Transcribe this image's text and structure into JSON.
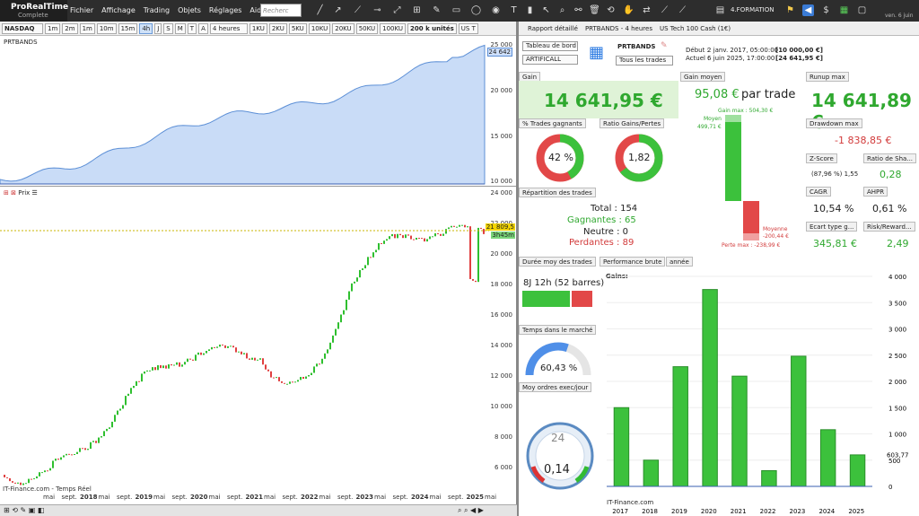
{
  "app": {
    "name": "ProRealTime",
    "edition": "Complete"
  },
  "menu": [
    "Fichier",
    "Affichage",
    "Trading",
    "Objets",
    "Réglages",
    "Aide"
  ],
  "search": {
    "placeholder": "Recherc"
  },
  "top_right": {
    "layout": "4.FORMATION",
    "date": "ven. 6 juin"
  },
  "chart_toolbar": {
    "symbol": "NASDAQ",
    "timeframes": [
      "1m",
      "2m",
      "1m",
      "10m",
      "15m",
      "4h",
      "J",
      "S",
      "M",
      "T",
      "A"
    ],
    "interval": "4 heures",
    "unit_buttons": [
      "1KU",
      "2KU",
      "5KU",
      "10KU",
      "20KU",
      "50KU",
      "100KU"
    ],
    "units": "200 k unités",
    "instrument_short": "US T"
  },
  "equity_pane": {
    "label": "PRTBANDS",
    "last_value": "24 642",
    "y_ticks": [
      "25 000",
      "20 000",
      "15 000",
      "10 000"
    ]
  },
  "price_pane": {
    "label": "Prix",
    "last_price": "21 809,5",
    "countdown": "3h45m",
    "y_ticks": [
      "24 000",
      "22 000",
      "20 000",
      "18 000",
      "16 000",
      "14 000",
      "12 000",
      "10 000",
      "8 000",
      "6 000"
    ],
    "x_ticks": [
      "mai",
      "sept.",
      "2018",
      "mai",
      "sept.",
      "2019",
      "mai",
      "sept.",
      "2020",
      "mai",
      "sept.",
      "2021",
      "mai",
      "sept.",
      "2022",
      "mai",
      "sept.",
      "2023",
      "mai",
      "sept.",
      "2024",
      "mai",
      "sept.",
      "2025",
      "mai"
    ],
    "source": "IT-Finance.com - Temps Réel"
  },
  "report_header": {
    "title": "Rapport détaillé",
    "system": "PRTBANDS - 4 heures",
    "instrument": "US Tech 100 Cash (1€)"
  },
  "report": {
    "view_select": "Tableau de bord",
    "sub_select": "ARTIFICALL",
    "system_name": "PRTBANDS",
    "trades_select": "Tous les trades",
    "start_label": "Début :",
    "start_value": "2 janv. 2017, 05:00:00",
    "start_capital": "[10 000,00 €]",
    "current_label": "Actuel :",
    "current_value": "6 juin 2025, 17:00:00",
    "current_capital": "[24 641,95 €]",
    "gain_title": "Gain",
    "gain_value": "14 641,95 €",
    "avg_gain_title": "Gain moyen",
    "avg_gain_value": "95,08 €",
    "avg_gain_suffix": "par trade",
    "gain_max_label": "Gain max : 504,30 €",
    "avg_label": "Moyen",
    "avg_win_label": "499,71 €",
    "avg_lose_label": "Moyenne",
    "avg_lose_value": "-200,44 €",
    "loss_max_label": "Perte max : -238,99 €",
    "runup_title": "Runup max",
    "runup_value": "14 641,89 €",
    "drawdown_title": "Drawdown max",
    "drawdown_value": "-1 838,85 €",
    "zscore_title": "Z-Score",
    "zscore_value": "(87,96 %) 1,55",
    "sharpe_title": "Ratio de Sha...",
    "sharpe_value": "0,28",
    "cagr_title": "CAGR",
    "cagr_value": "10,54 %",
    "ahpr_title": "AHPR",
    "ahpr_value": "0,61 %",
    "ecart_title": "Ecart type g...",
    "ecart_value": "345,81 €",
    "risk_title": "Risk/Reward...",
    "risk_value": "2,49",
    "pct_win_title": "% Trades gagnants",
    "pct_win_value": "42 %",
    "pct_win_fraction": 0.42,
    "ratio_title": "Ratio Gains/Pertes",
    "ratio_value": "1,82",
    "ratio_fraction": 0.645,
    "repartition_title": "Répartition des trades",
    "total_label": "Total : 154",
    "gagnantes_label": "Gagnantes : 65",
    "neutre_label": "Neutre : 0",
    "perdantes_label": "Perdantes : 89",
    "duree_title": "Durée moy des trades",
    "duree_value": "8J 12h (52 barres)",
    "duree_fraction": 0.7,
    "temps_title": "Temps dans le marché",
    "temps_value": "60,43 %",
    "temps_fraction": 0.6043,
    "moy_ordres_title": "Moy ordres exec/jour",
    "moy_ordres_value": "0,14",
    "gauge_label": "24",
    "perf_title": "Performance brute",
    "perf_period": "année",
    "gains_label": "Gains:",
    "perf_last": "603,77",
    "footer": "IT-Finance.com"
  },
  "colors": {
    "green": "#2fbf2f",
    "red": "#e04040",
    "blue": "#4f8fe8",
    "equity_fill": "#c9dcf7"
  },
  "chart_data": {
    "type": "bar",
    "title": "",
    "categories": [
      "2017",
      "2018",
      "2019",
      "2020",
      "2021",
      "2022",
      "2023",
      "2024",
      "2025"
    ],
    "values": [
      1500,
      500,
      2280,
      3750,
      2100,
      300,
      2480,
      1080,
      600
    ],
    "y_ticks": [
      "4 000",
      "3 500",
      "3 000",
      "2 500",
      "2 000",
      "1 500",
      "1 000",
      "500",
      "0"
    ],
    "ylim": [
      0,
      4000
    ],
    "xlabel": "",
    "ylabel": ""
  }
}
